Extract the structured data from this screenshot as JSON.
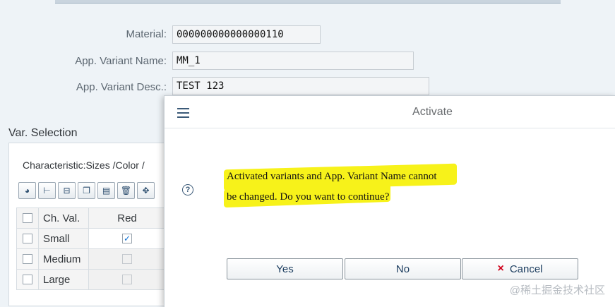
{
  "header": {
    "material_label": "Material:",
    "material_value": "000000000000000110",
    "variant_name_label": "App. Variant Name:",
    "variant_name_value": "MM_1",
    "variant_desc_label": "App. Variant Desc.:",
    "variant_desc_value": "TEST 123"
  },
  "var_selection": {
    "title": "Var. Selection",
    "characteristic": "Characteristic:Sizes /Color /",
    "toolbar_icons": [
      "select-all-icon",
      "expand-icon",
      "collapse-icon",
      "copy-icon",
      "paste-icon",
      "delete-icon",
      "move-icon"
    ],
    "columns": [
      "Ch. Val.",
      "Red"
    ],
    "rows": [
      {
        "value": "Small",
        "red_checked": "✓"
      },
      {
        "value": "Medium",
        "red_checked": ""
      },
      {
        "value": "Large",
        "red_checked": ""
      }
    ]
  },
  "dialog": {
    "title": "Activate",
    "message_line1": "Activated variants and App. Variant Name cannot",
    "message_line2": "be changed. Do you want to continue?",
    "yes_label": "Yes",
    "no_label": "No",
    "cancel_label": "Cancel",
    "cancel_icon": "×"
  },
  "watermark": "@稀土掘金技术社区",
  "colors": {
    "highlight": "#f7f21a",
    "cancel_icon": "#d0021b",
    "accent": "#0a6ed1"
  }
}
